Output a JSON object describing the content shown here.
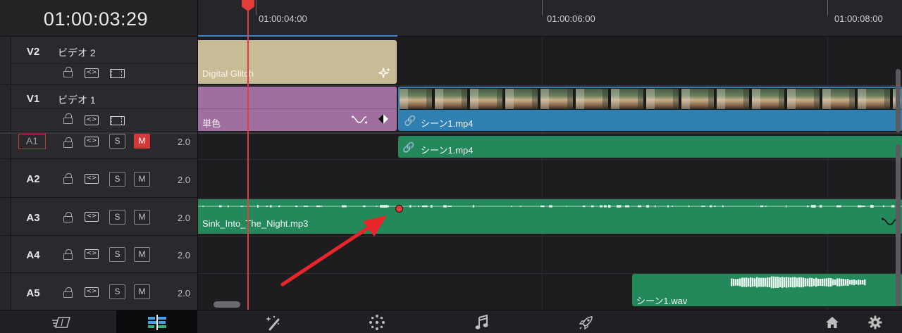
{
  "timecode": "01:00:03:29",
  "ruler": {
    "labels": [
      "01:00:04:00",
      "01:00:06:00",
      "01:00:08:00"
    ]
  },
  "tracks": {
    "v2": {
      "id": "V2",
      "name": "ビデオ 2"
    },
    "v1": {
      "id": "V1",
      "name": "ビデオ 1"
    },
    "a1": {
      "id": "A1",
      "volume": "2.0",
      "solo": "S",
      "mute": "M",
      "mute_active": true
    },
    "a2": {
      "id": "A2",
      "volume": "2.0",
      "solo": "S",
      "mute": "M"
    },
    "a3": {
      "id": "A3",
      "volume": "2.0",
      "solo": "S",
      "mute": "M"
    },
    "a4": {
      "id": "A4",
      "volume": "2.0",
      "solo": "S",
      "mute": "M"
    },
    "a5": {
      "id": "A5",
      "volume": "2.0",
      "solo": "S",
      "mute": "M"
    }
  },
  "clips": {
    "digital_glitch": "Digital Glitch",
    "solid_color": "単色",
    "scene1_video": "シーン1.mp4",
    "scene1_audio": "シーン1.mp4",
    "music": "Sink_Into_The_Night.mp3",
    "scene1_wav": "シーン1.wav"
  },
  "colors": {
    "playhead": "#e43c3c",
    "v2_clip": "#c8bc96",
    "solid_clip": "#a06fa0",
    "video_clip": "#2f7fb0",
    "audio_clip": "#23885a",
    "mute_active": "#d23a3a",
    "annotation_arrow": "#e8252b"
  },
  "bottom_toolbar": {
    "items": [
      "cut-page",
      "edit-page",
      "fusion-page",
      "color-page",
      "fairlight-page",
      "deliver-page",
      "home",
      "settings"
    ],
    "active": "edit-page"
  }
}
